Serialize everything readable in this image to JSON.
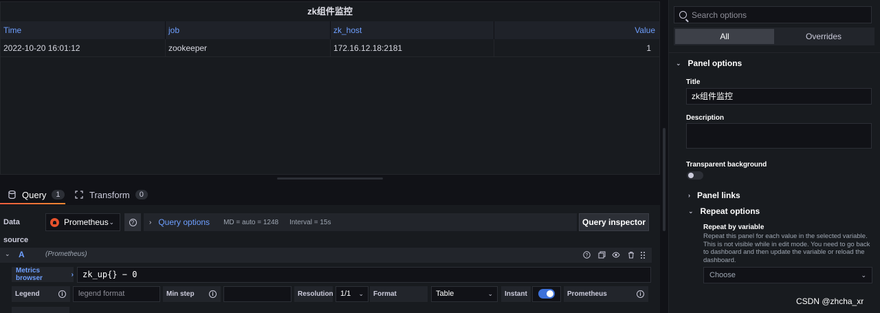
{
  "panel": {
    "title": "zk组件监控",
    "columns": [
      "Time",
      "job",
      "zk_host",
      "Value"
    ],
    "rows": [
      [
        "2022-10-20 16:01:12",
        "zookeeper",
        "172.16.12.18:2181",
        "1"
      ]
    ]
  },
  "tabs": {
    "query_label": "Query",
    "query_count": "1",
    "transform_label": "Transform",
    "transform_count": "0"
  },
  "datasource": {
    "label": "Data source",
    "selected": "Prometheus",
    "query_options_label": "Query options",
    "md": "MD = auto = 1248",
    "interval": "Interval = 15s",
    "inspector_label": "Query inspector"
  },
  "query": {
    "ref": "A",
    "datasource_hint": "(Prometheus)",
    "metrics_browser_label": "Metrics browser",
    "expression": "zk_up{} − 0",
    "legend_label": "Legend",
    "legend_placeholder": "legend format",
    "min_step_label": "Min step",
    "resolution_label": "Resolution",
    "resolution_value": "1/1",
    "format_label": "Format",
    "format_value": "Table",
    "instant_label": "Instant",
    "instant_on": true,
    "exemplar_label": "Prometheus"
  },
  "options": {
    "search_placeholder": "Search options",
    "seg_all": "All",
    "seg_overrides": "Overrides",
    "panel_options_label": "Panel options",
    "title_label": "Title",
    "title_value": "zk组件监控",
    "description_label": "Description",
    "transparent_label": "Transparent background",
    "panel_links_label": "Panel links",
    "repeat_options_label": "Repeat options",
    "repeat_by_label": "Repeat by variable",
    "repeat_desc": "Repeat this panel for each value in the selected variable. This is not visible while in edit mode. You need to go back to dashboard and then update the variable or reload the dashboard.",
    "choose_placeholder": "Choose"
  },
  "watermark": "CSDN @zhcha_xr",
  "colors": {
    "accent_blue": "#6e9fff",
    "prometheus_orange": "#e6522c",
    "toggle_blue": "#3d71d9",
    "tab_underline": "#f55f3e"
  }
}
